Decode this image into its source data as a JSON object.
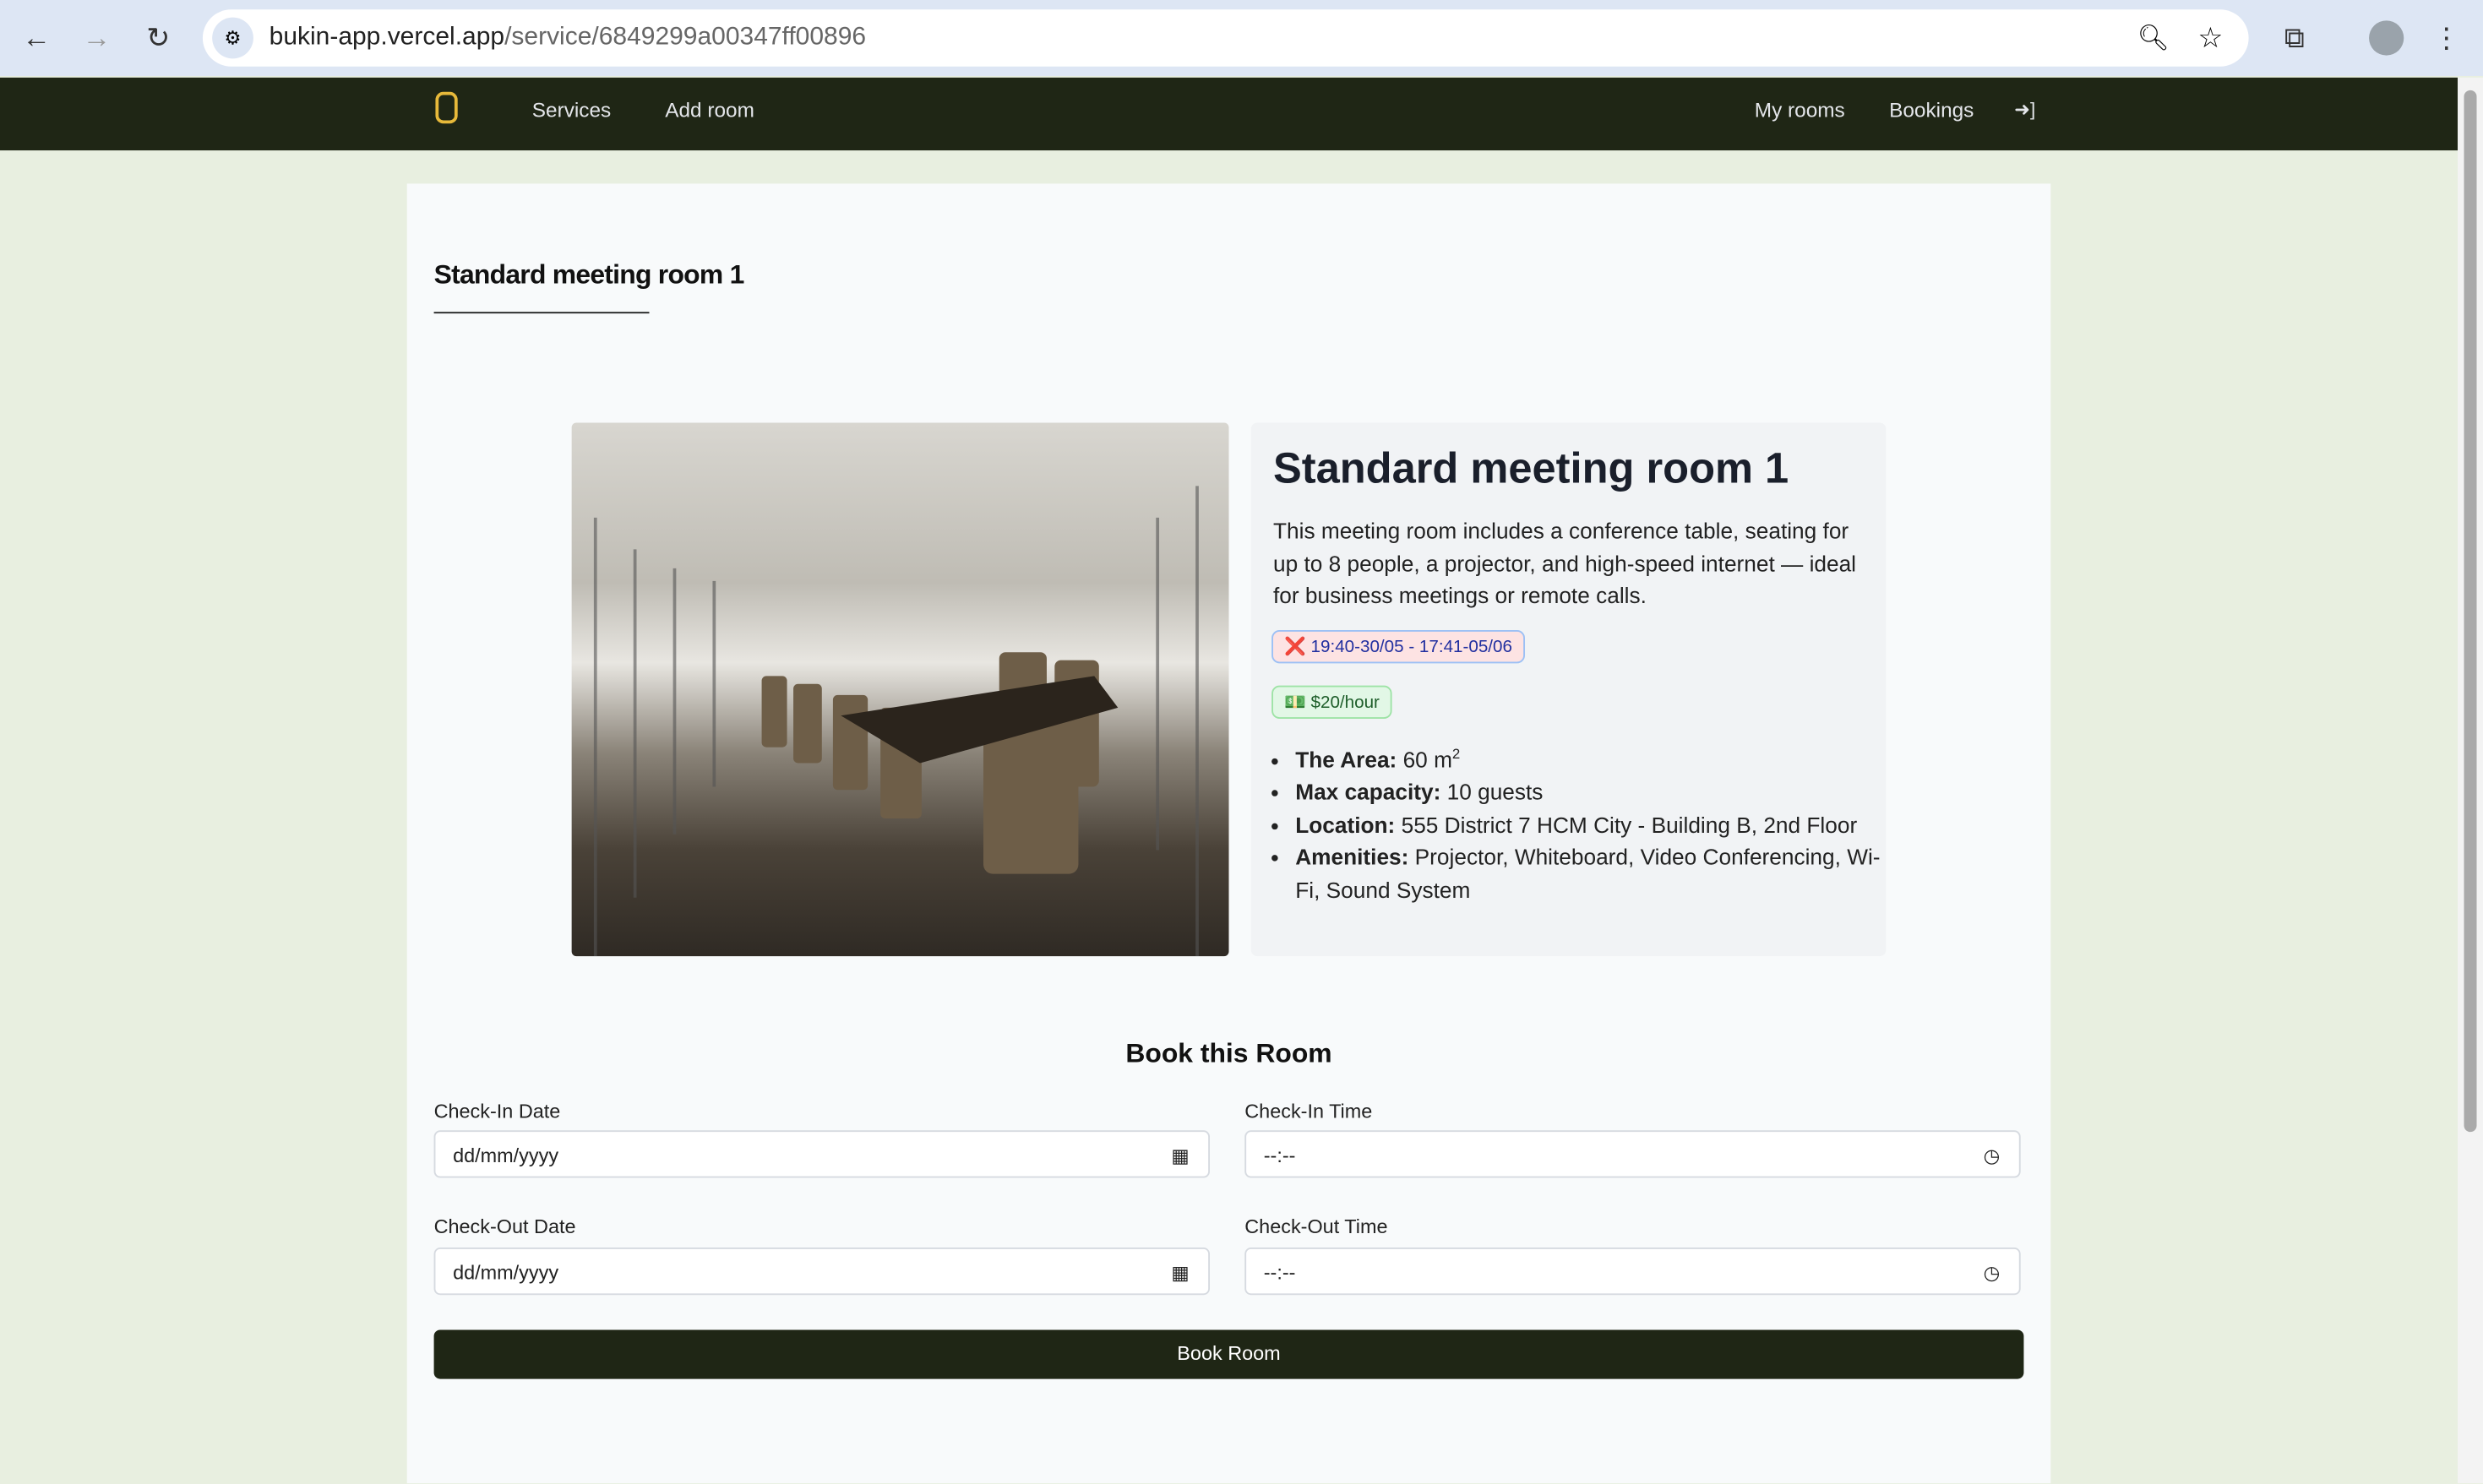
{
  "browser": {
    "url_host": "bukin-app.vercel.app",
    "url_path": "/service/6849299a00347ff00896"
  },
  "nav": {
    "items": [
      "Services",
      "Add room"
    ],
    "right": [
      "My rooms",
      "Bookings"
    ]
  },
  "page": {
    "title": "Standard meeting room 1"
  },
  "room": {
    "name": "Standard meeting room 1",
    "description": "This meeting room includes a conference table, seating for up to 8 people, a projector, and high-speed internet — ideal for business meetings or remote calls.",
    "availability": "19:40-30/05 - 17:41-05/06",
    "availability_icon": "❌",
    "price": "$20/hour",
    "price_icon": "💵",
    "details": [
      {
        "label": "The Area:",
        "value": " 60 m",
        "sup": "2"
      },
      {
        "label": "Max capacity:",
        "value": " 10 guests"
      },
      {
        "label": "Location:",
        "value": " 555 District 7 HCM City - Building B, 2nd Floor"
      },
      {
        "label": "Amenities:",
        "value": " Projector, Whiteboard, Video Conferencing, Wi-Fi, Sound System"
      }
    ]
  },
  "booking": {
    "title": "Book this Room",
    "checkin_date_label": "Check-In Date",
    "checkin_date_value": "dd/mm/yyyy",
    "checkin_time_label": "Check-In Time",
    "checkin_time_value": "--:--",
    "checkout_date_label": "Check-Out Date",
    "checkout_date_value": "dd/mm/yyyy",
    "checkout_time_label": "Check-Out Time",
    "checkout_time_value": "--:--",
    "submit": "Book Room"
  }
}
